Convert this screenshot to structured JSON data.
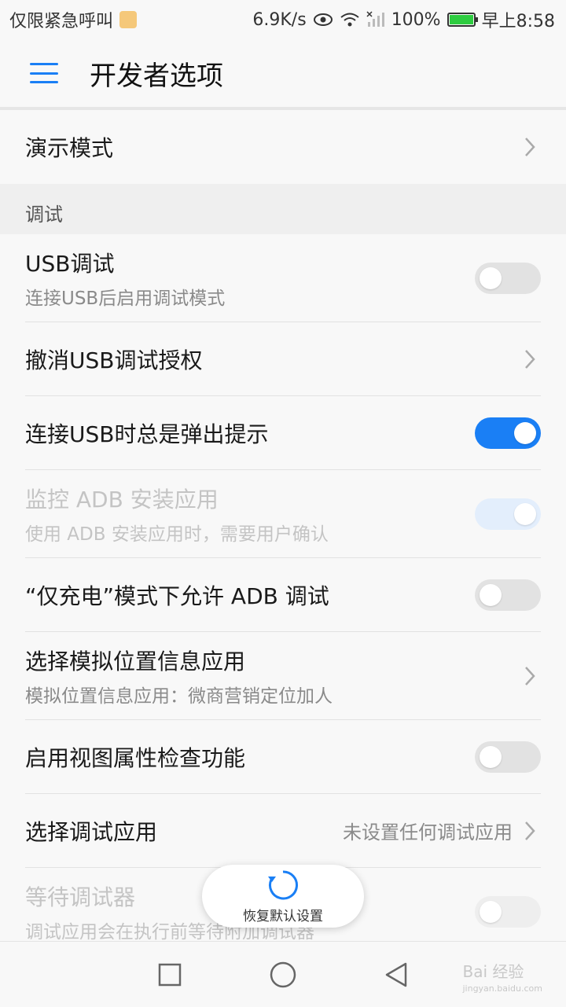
{
  "status_bar": {
    "carrier": "仅限紧急呼叫",
    "speed": "6.9K/s",
    "battery": "100%",
    "time": "早上8:58"
  },
  "app_bar": {
    "title": "开发者选项"
  },
  "rows_top": [
    {
      "title": "演示模式"
    }
  ],
  "section": {
    "label": "调试"
  },
  "rows": [
    {
      "title": "USB调试",
      "sub": "连接USB后启用调试模式"
    },
    {
      "title": "撤消USB调试授权"
    },
    {
      "title": "连接USB时总是弹出提示"
    },
    {
      "title": "监控 ADB 安装应用",
      "sub": "使用 ADB 安装应用时，需要用户确认"
    },
    {
      "title": "“仅充电”模式下允许 ADB 调试"
    },
    {
      "title": "选择模拟位置信息应用",
      "sub": "模拟位置信息应用：微商营销定位加人"
    },
    {
      "title": "启用视图属性检查功能"
    },
    {
      "title": "选择调试应用",
      "value": "未设置任何调试应用"
    },
    {
      "title": "等待调试器",
      "sub": "调试应用会在执行前等待附加调试器"
    }
  ],
  "fab": {
    "label": "恢复默认设置"
  },
  "watermark": {
    "brand": "Bai 经验",
    "url": "jingyan.baidu.com"
  },
  "colors": {
    "accent": "#1a7ff5",
    "toggle_off": "#e2e2e2"
  }
}
